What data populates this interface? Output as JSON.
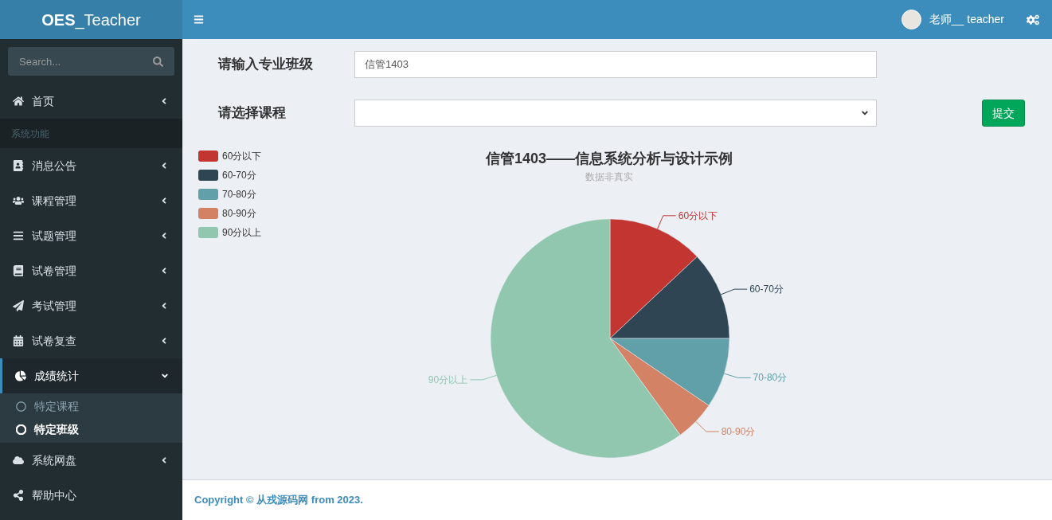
{
  "logo": {
    "bold": "OES",
    "rest": "_Teacher"
  },
  "header": {
    "user": "老师__ teacher"
  },
  "sidebar": {
    "search": {
      "placeholder": "Search..."
    },
    "items": [
      {
        "kind": "link",
        "label": "首页",
        "expanded": false,
        "selected": false
      },
      {
        "kind": "header",
        "label": "系统功能"
      },
      {
        "kind": "link",
        "label": "消息公告",
        "expanded": false,
        "selected": false
      },
      {
        "kind": "link",
        "label": "课程管理",
        "expanded": false,
        "selected": false
      },
      {
        "kind": "link",
        "label": "试题管理",
        "expanded": false,
        "selected": false
      },
      {
        "kind": "link",
        "label": "试卷管理",
        "expanded": false,
        "selected": false
      },
      {
        "kind": "link",
        "label": "考试管理",
        "expanded": false,
        "selected": false
      },
      {
        "kind": "link",
        "label": "试卷复查",
        "expanded": false,
        "selected": false
      },
      {
        "kind": "link",
        "label": "成绩统计",
        "expanded": true,
        "selected": true,
        "children": [
          {
            "label": "特定课程",
            "selected": false
          },
          {
            "label": "特定班级",
            "selected": true
          }
        ]
      },
      {
        "kind": "link",
        "label": "系统网盘",
        "expanded": false,
        "selected": false
      },
      {
        "kind": "plain",
        "label": "帮助中心",
        "expanded": false,
        "selected": false
      }
    ]
  },
  "form": {
    "class_label": "请输入专业班级",
    "class_value": "信管1403",
    "course_label": "请选择课程",
    "submit": "提交"
  },
  "chart": {
    "subtitle": "数据非真实",
    "chart_data": {
      "type": "pie",
      "title": "信管1403——信息系统分析与设计示例",
      "categories": [
        "60分以下",
        "60-70分",
        "70-80分",
        "80-90分",
        "90分以上"
      ],
      "legend": "top-left",
      "series": [
        {
          "values": [
            13,
            12,
            9.5,
            5.5,
            60
          ],
          "colors": [
            "#c23531",
            "#2f4554",
            "#61a0a8",
            "#d48265",
            "#91c7ae"
          ]
        }
      ]
    }
  },
  "footer": {
    "copyright": "Copyright © 从戎源码网 from 2023."
  }
}
